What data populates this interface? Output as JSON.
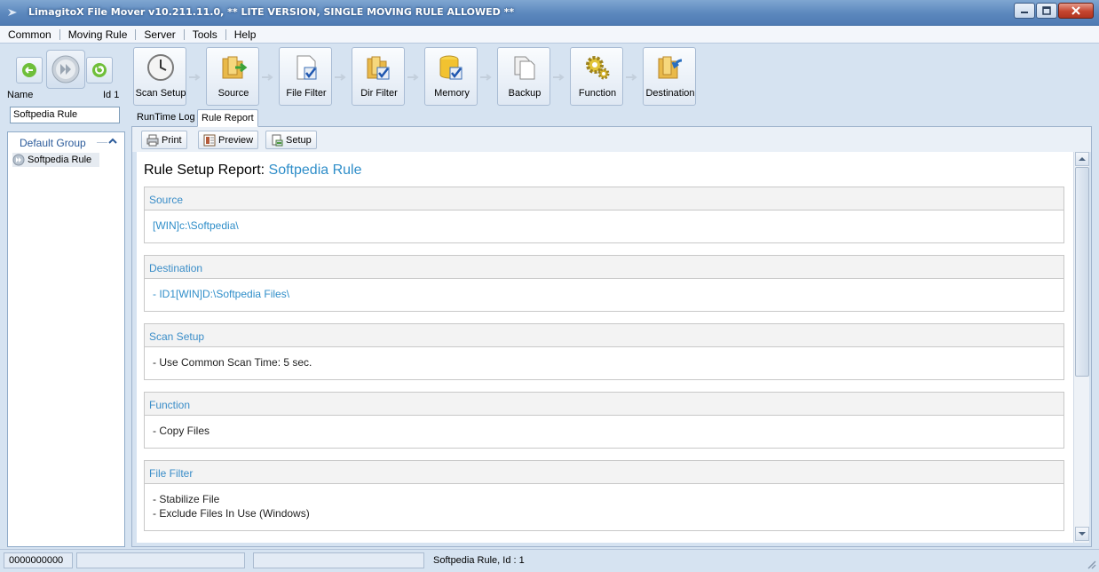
{
  "window": {
    "title": "LimagitoX File Mover v10.211.11.0,  ** LITE VERSION, SINGLE MOVING RULE ALLOWED **",
    "icons": [
      "app-icon",
      "minimize-icon",
      "maximize-icon",
      "close-icon"
    ]
  },
  "menu": [
    "Common",
    "Moving Rule",
    "Server",
    "Tools",
    "Help"
  ],
  "left_panel": {
    "name_label": "Name",
    "id_label": "Id 1",
    "name_value": "Softpedia Rule",
    "group_label": "Default Group",
    "tree_item": "Softpedia Rule",
    "icons": [
      "undo-icon",
      "run-rule-icon",
      "redo-icon",
      "collapse-icon",
      "rule-icon"
    ]
  },
  "toolbar": [
    {
      "label": "Scan Setup",
      "icon": "clock-icon"
    },
    {
      "label": "Source",
      "icon": "folder-arrow-icon"
    },
    {
      "label": "File Filter",
      "icon": "file-check-icon"
    },
    {
      "label": "Dir Filter",
      "icon": "folder-check-icon"
    },
    {
      "label": "Memory",
      "icon": "database-check-icon"
    },
    {
      "label": "Backup",
      "icon": "files-copy-icon"
    },
    {
      "label": "Function",
      "icon": "gear-icon"
    },
    {
      "label": "Destination",
      "icon": "folder-in-icon"
    }
  ],
  "tabs": [
    "RunTime Log",
    "Rule Report"
  ],
  "report_toolbar": [
    {
      "label": "Print",
      "icon": "printer-icon"
    },
    {
      "label": "Preview",
      "icon": "preview-icon"
    },
    {
      "label": "Setup",
      "icon": "page-setup-icon"
    }
  ],
  "report": {
    "title_prefix": "Rule Setup Report:",
    "title_rule": "Softpedia Rule",
    "sections": [
      {
        "heading": "Source",
        "lines": [
          "[WIN]c:\\Softpedia\\"
        ],
        "link": true
      },
      {
        "heading": "Destination",
        "lines": [
          "- ID1[WIN]D:\\Softpedia Files\\"
        ],
        "link": true
      },
      {
        "heading": "Scan Setup",
        "lines": [
          "- Use Common Scan Time: 5 sec."
        ],
        "link": false
      },
      {
        "heading": "Function",
        "lines": [
          "- Copy Files"
        ],
        "link": false
      },
      {
        "heading": "File Filter",
        "lines": [
          "- Stabilize File",
          "- Exclude Files In Use (Windows)"
        ],
        "link": false
      }
    ]
  },
  "status": {
    "counter": "0000000000",
    "panel2": "",
    "panel3": "",
    "rule": "Softpedia Rule, Id : 1"
  },
  "colors": {
    "accent": "#2f8ec9",
    "titlebar": "#5b87bd",
    "background": "#d6e3f1"
  }
}
